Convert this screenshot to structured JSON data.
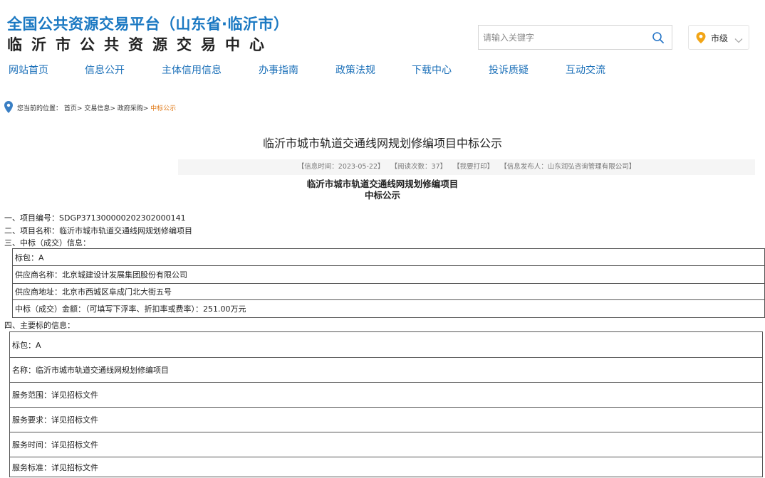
{
  "header": {
    "title_line1": "全国公共资源交易平台（山东省·临沂市）",
    "title_line2": "临沂市公共资源交易中心"
  },
  "search": {
    "placeholder": "请输入关键字"
  },
  "city_selector": {
    "label": "市级"
  },
  "nav": [
    "网站首页",
    "信息公开",
    "主体信用信息",
    "办事指南",
    "政策法规",
    "下载中心",
    "投诉质疑",
    "互动交流"
  ],
  "breadcrumb": {
    "prefix": "您当前的位置：",
    "items": [
      "首页>",
      "交易信息>",
      "政府采购>"
    ],
    "current": "中标公示"
  },
  "article": {
    "title": "临沂市城市轨道交通线网规划修编项目中标公示",
    "meta": {
      "time": "【信息时间：2023-05-22】",
      "views": "【阅读次数：37】",
      "print": "【我要打印】",
      "publisher": "【信息发布人：山东润弘咨询管理有限公司】"
    },
    "subtitle_line1": "临沂市城市轨道交通线网规划修编项目",
    "subtitle_line2": "中标公示",
    "section1": "一、项目编号：SDGP371300000202302000141",
    "section2": "二、项目名称：临沂市城市轨道交通线网规划修编项目",
    "section3": "三、中标（成交）信息：",
    "award_table": [
      "标包：A",
      "供应商名称：北京城建设计发展集团股份有限公司",
      "供应商地址：北京市西城区阜成门北大街五号",
      "中标（成交）金额：（可填写下浮率、折扣率或费率）：251.00万元"
    ],
    "section4": "四、主要标的信息：",
    "subject_table": [
      "标包：A",
      "名称：临沂市城市轨道交通线网规划修编项目",
      "服务范围：详见招标文件",
      "服务要求：详见招标文件",
      "服务时间：详见招标文件",
      "服务标准：详见招标文件"
    ]
  }
}
